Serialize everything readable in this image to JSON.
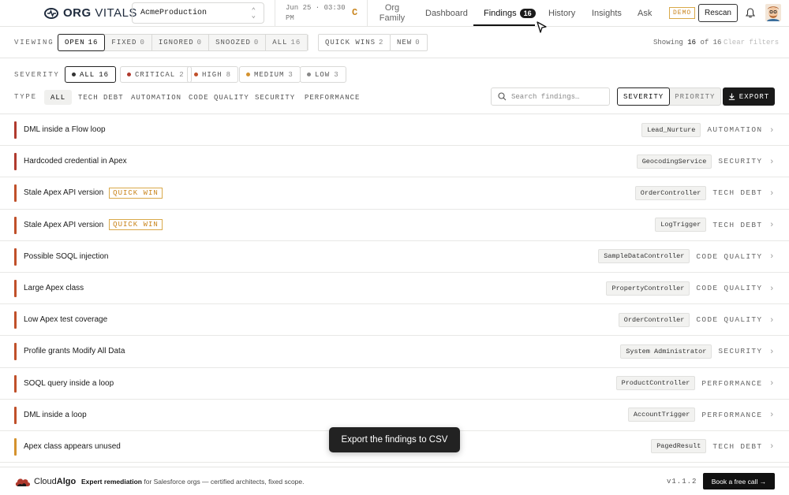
{
  "app": {
    "logo_bold": "ORG",
    "logo_light": "VITALS",
    "org_selector": "AcmeProduction",
    "scan_date": "Jun 25 · 03:30 PM",
    "grade": "C",
    "org_family": "Org Family"
  },
  "nav": {
    "dashboard": "Dashboard",
    "findings": "Findings",
    "findings_count": "16",
    "history": "History",
    "insights": "Insights",
    "ask": "Ask",
    "demo_badge": "DEMO",
    "rescan": "Rescan"
  },
  "viewing": {
    "label": "VIEWING",
    "tabs": [
      {
        "label": "OPEN",
        "count": "16"
      },
      {
        "label": "FIXED",
        "count": "0"
      },
      {
        "label": "IGNORED",
        "count": "0"
      },
      {
        "label": "SNOOZED",
        "count": "0"
      },
      {
        "label": "ALL",
        "count": "16"
      }
    ],
    "quick_wins": {
      "label": "QUICK WINS",
      "count": "2"
    },
    "new": {
      "label": "NEW",
      "count": "0"
    },
    "showing_prefix": "Showing",
    "showing_count": "16",
    "showing_of": "of",
    "showing_total": "16",
    "clear_filters": "Clear filters"
  },
  "severity": {
    "label": "SEVERITY",
    "options": [
      {
        "label": "ALL",
        "count": "16",
        "color": "#333333"
      },
      {
        "label": "CRITICAL",
        "count": "2",
        "color": "#b03a2e"
      },
      {
        "label": "HIGH",
        "count": "8",
        "color": "#c0502a"
      },
      {
        "label": "MEDIUM",
        "count": "3",
        "color": "#d4922e"
      },
      {
        "label": "LOW",
        "count": "3",
        "color": "#888888"
      }
    ]
  },
  "type": {
    "label": "TYPE",
    "options": [
      "ALL",
      "TECH DEBT",
      "AUTOMATION",
      "CODE QUALITY",
      "SECURITY",
      "PERFORMANCE"
    ]
  },
  "search": {
    "placeholder": "Search findings…"
  },
  "sort": {
    "severity": "SEVERITY",
    "priority": "PRIORITY"
  },
  "export": "EXPORT",
  "quick_win_label": "QUICK WIN",
  "findings": [
    {
      "title": "DML inside a Flow loop",
      "component": "Lead_Nurture",
      "category": "AUTOMATION",
      "severity_color": "#b03a2e",
      "quick_win": false
    },
    {
      "title": "Hardcoded credential in Apex",
      "component": "GeocodingService",
      "category": "SECURITY",
      "severity_color": "#b03a2e",
      "quick_win": false
    },
    {
      "title": "Stale Apex API version",
      "component": "OrderController",
      "category": "TECH DEBT",
      "severity_color": "#c0502a",
      "quick_win": true
    },
    {
      "title": "Stale Apex API version",
      "component": "LogTrigger",
      "category": "TECH DEBT",
      "severity_color": "#c0502a",
      "quick_win": true
    },
    {
      "title": "Possible SOQL injection",
      "component": "SampleDataController",
      "category": "CODE QUALITY",
      "severity_color": "#c0502a",
      "quick_win": false
    },
    {
      "title": "Large Apex class",
      "component": "PropertyController",
      "category": "CODE QUALITY",
      "severity_color": "#c0502a",
      "quick_win": false
    },
    {
      "title": "Low Apex test coverage",
      "component": "OrderController",
      "category": "CODE QUALITY",
      "severity_color": "#c0502a",
      "quick_win": false
    },
    {
      "title": "Profile grants Modify All Data",
      "component": "System Administrator",
      "category": "SECURITY",
      "severity_color": "#c0502a",
      "quick_win": false
    },
    {
      "title": "SOQL query inside a loop",
      "component": "ProductController",
      "category": "PERFORMANCE",
      "severity_color": "#c0502a",
      "quick_win": false
    },
    {
      "title": "DML inside a loop",
      "component": "AccountTrigger",
      "category": "PERFORMANCE",
      "severity_color": "#c0502a",
      "quick_win": false
    },
    {
      "title": "Apex class appears unused",
      "component": "PagedResult",
      "category": "TECH DEBT",
      "severity_color": "#d4922e",
      "quick_win": false
    }
  ],
  "toast": "Export the findings to CSV",
  "footer": {
    "brand_light": "Cloud",
    "brand_bold": "Algo",
    "text_bold": "Expert remediation",
    "text_rest": " for Salesforce orgs — certified architects, fixed scope.",
    "version": "v1.1.2",
    "cta": "Book a free call →"
  }
}
